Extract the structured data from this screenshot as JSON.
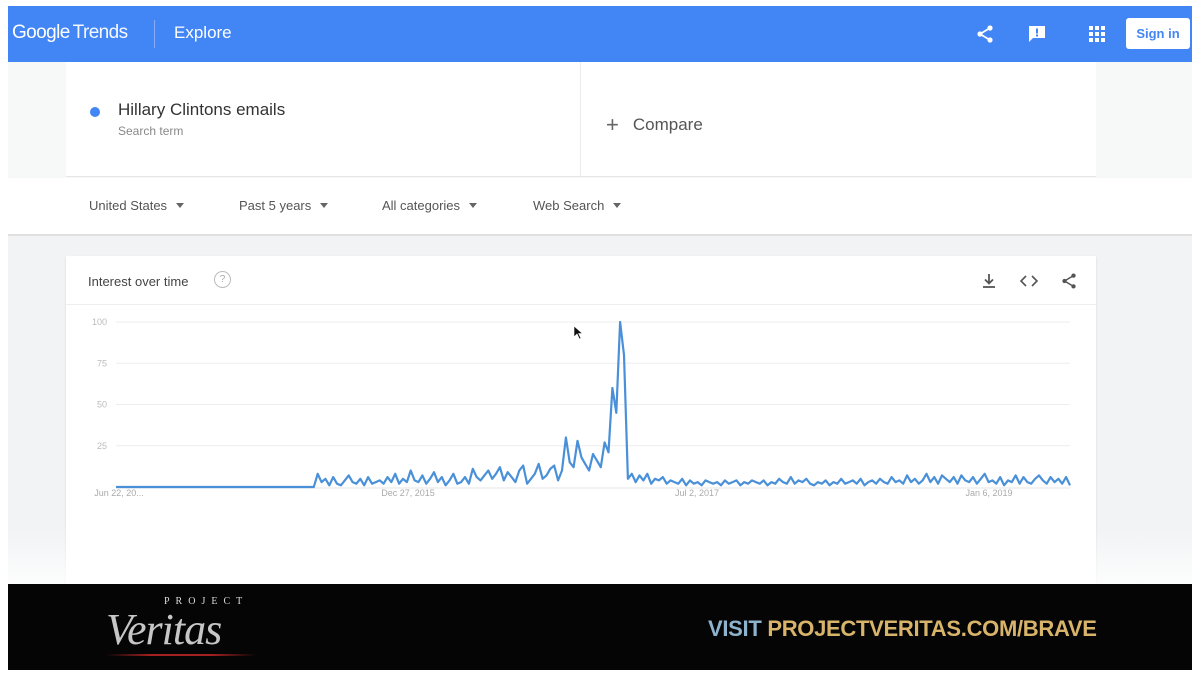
{
  "header": {
    "logo_google": "Google",
    "logo_trends": "Trends",
    "explore_label": "Explore",
    "signin_label": "Sign in",
    "icons": [
      "share-icon",
      "feedback-icon",
      "apps-grid-icon"
    ],
    "accent_color": "#4285f4"
  },
  "search_term": {
    "name": "Hillary Clintons emails",
    "sub": "Search term",
    "dot_color": "#4285f4"
  },
  "compare": {
    "plus": "+",
    "label": "Compare"
  },
  "filters": {
    "region": "United States",
    "time": "Past 5 years",
    "category": "All categories",
    "search_type": "Web Search"
  },
  "chart_card": {
    "title": "Interest over time",
    "help": "?",
    "icons": [
      "download-icon",
      "embed-code-icon",
      "share-icon"
    ]
  },
  "chart_data": {
    "type": "line",
    "ylim": [
      0,
      100
    ],
    "yticks": [
      100,
      75,
      50,
      25
    ],
    "xticks": [
      "Jun 22, 20...",
      "Dec 27, 2015",
      "Jul 2, 2017",
      "Jan 6, 2019"
    ],
    "series": [
      {
        "color": "#4a90d9",
        "values": [
          0,
          0,
          0,
          0,
          0,
          0,
          0,
          0,
          0,
          0,
          0,
          0,
          0,
          0,
          0,
          0,
          0,
          0,
          0,
          0,
          0,
          0,
          0,
          0,
          0,
          0,
          0,
          0,
          0,
          0,
          0,
          0,
          0,
          0,
          0,
          0,
          0,
          0,
          0,
          0,
          0,
          0,
          0,
          0,
          0,
          0,
          0,
          0,
          0,
          0,
          0,
          0,
          8,
          3,
          5,
          1,
          6,
          2,
          1,
          4,
          7,
          3,
          2,
          5,
          1,
          6,
          2,
          3,
          4,
          2,
          6,
          3,
          8,
          2,
          5,
          3,
          10,
          4,
          3,
          7,
          2,
          5,
          9,
          3,
          6,
          1,
          4,
          8,
          2,
          3,
          6,
          2,
          11,
          6,
          4,
          7,
          10,
          5,
          8,
          12,
          4,
          9,
          6,
          3,
          10,
          13,
          2,
          5,
          8,
          14,
          5,
          7,
          11,
          13,
          4,
          10,
          30,
          15,
          12,
          28,
          18,
          14,
          10,
          20,
          16,
          12,
          27,
          21,
          60,
          45,
          100,
          80,
          5,
          8,
          3,
          7,
          4,
          8,
          2,
          5,
          4,
          6,
          2,
          4,
          3,
          2,
          5,
          1,
          4,
          2,
          3,
          1,
          4,
          3,
          2,
          3,
          1,
          4,
          2,
          3,
          4,
          1,
          3,
          2,
          4,
          3,
          2,
          4,
          1,
          3,
          2,
          5,
          3,
          2,
          6,
          2,
          4,
          3,
          5,
          2,
          1,
          3,
          2,
          4,
          1,
          3,
          2,
          5,
          2,
          3,
          4,
          2,
          5,
          1,
          3,
          4,
          2,
          5,
          3,
          2,
          6,
          3,
          4,
          2,
          7,
          3,
          5,
          2,
          4,
          8,
          3,
          6,
          2,
          7,
          5,
          3,
          6,
          2,
          7,
          4,
          3,
          6,
          2,
          5,
          8,
          3,
          4,
          2,
          6,
          1,
          4,
          3,
          7,
          2,
          6,
          3,
          2,
          5,
          7,
          4,
          2,
          6,
          3,
          5,
          2,
          6,
          1
        ]
      }
    ]
  },
  "banner": {
    "logo_project": "PROJECT",
    "logo_veritas": "Veritas",
    "visit_prefix": "VISIT ",
    "visit_url": "PROJECTVERITAS.COM/BRAVE"
  }
}
